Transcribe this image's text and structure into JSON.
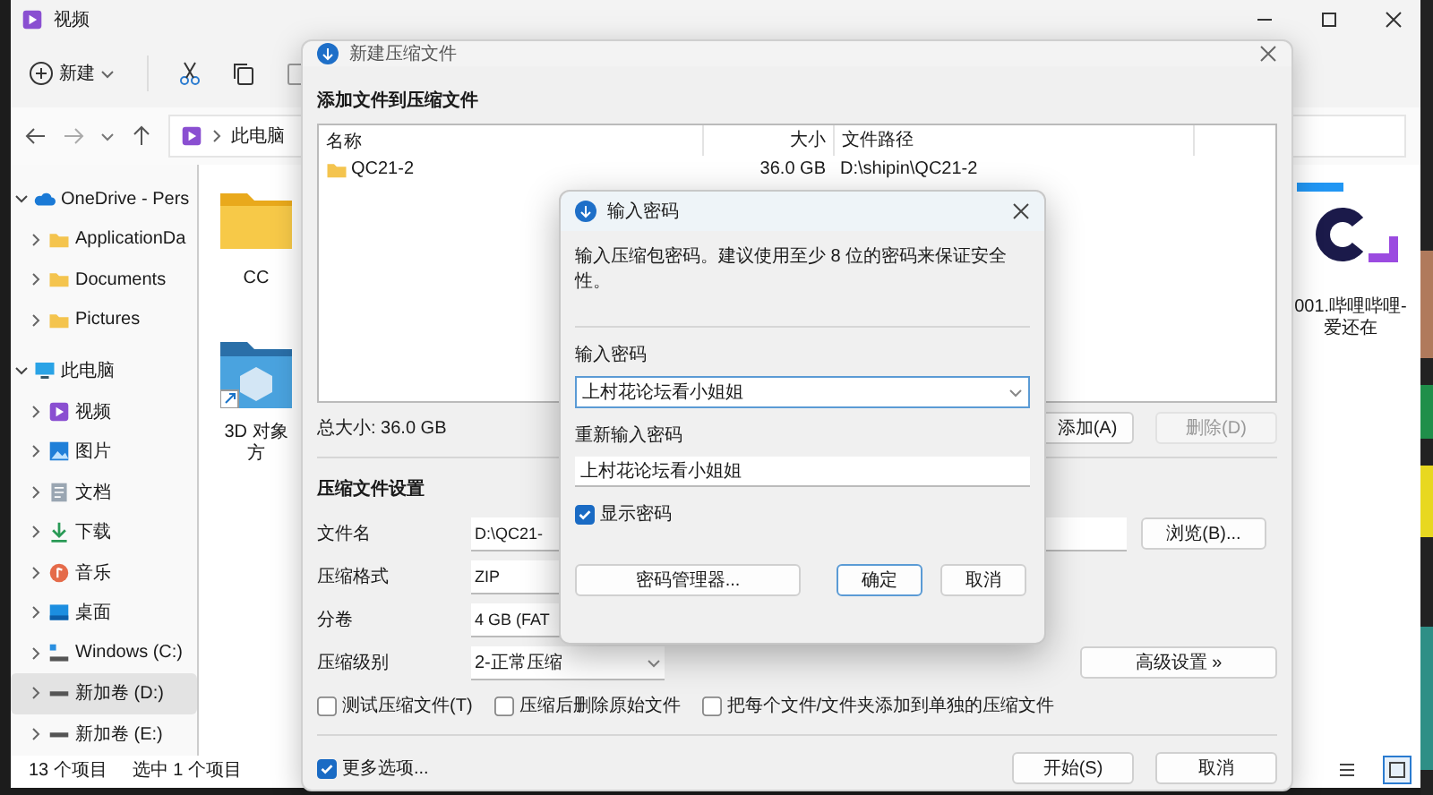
{
  "explorer": {
    "title": "视频",
    "new_button": "新建",
    "address_crumb": "此电脑",
    "sidebar": {
      "items": [
        {
          "label": "OneDrive - Pers",
          "expanded": true,
          "selected": false,
          "children": [
            {
              "label": "ApplicationDa",
              "expanded": false,
              "selected": false
            },
            {
              "label": "Documents",
              "expanded": false,
              "selected": false
            },
            {
              "label": "Pictures",
              "expanded": false,
              "selected": false
            }
          ]
        },
        {
          "label": "此电脑",
          "expanded": true,
          "selected": false,
          "children": [
            {
              "label": "视频",
              "expanded": false,
              "selected": false
            },
            {
              "label": "图片",
              "expanded": false,
              "selected": false
            },
            {
              "label": "文档",
              "expanded": false,
              "selected": false
            },
            {
              "label": "下载",
              "expanded": false,
              "selected": false
            },
            {
              "label": "音乐",
              "expanded": false,
              "selected": false
            },
            {
              "label": "桌面",
              "expanded": false,
              "selected": false
            },
            {
              "label": "Windows (C:)",
              "expanded": false,
              "selected": false
            },
            {
              "label": "新加卷 (D:)",
              "expanded": false,
              "selected": true
            },
            {
              "label": "新加卷 (E:)",
              "expanded": false,
              "selected": false
            }
          ]
        }
      ]
    },
    "files": [
      {
        "kind": "folder",
        "lines": [
          "CC"
        ]
      },
      {
        "kind": "folder-3d",
        "lines": [
          "3D 对象",
          "方"
        ]
      },
      {
        "kind": "video",
        "lines": [
          "001.哔哩哔哩-",
          "爱还在"
        ]
      }
    ],
    "status_bar": {
      "count": "13 个项目",
      "selection": "选中 1 个项目"
    },
    "view_buttons": [
      {
        "kind": "details",
        "selected": false
      },
      {
        "kind": "tiles",
        "selected": true
      }
    ]
  },
  "compress_dialog": {
    "title": "新建压缩文件",
    "files_heading": "添加文件到压缩文件",
    "columns": [
      "名称",
      "大小",
      "文件路径"
    ],
    "rows": [
      {
        "name": "QC21-2",
        "size": "36.0 GB",
        "path": "D:\\shipin\\QC21-2"
      }
    ],
    "total": "总大小: 36.0 GB",
    "list_buttons": [
      {
        "label": "添加(A)",
        "disabled": false
      },
      {
        "label": "删除(D)",
        "disabled": true
      }
    ],
    "settings_heading": "压缩文件设置",
    "fields": [
      {
        "label": "文件名",
        "value": "D:\\QC21-",
        "kind": "wide"
      },
      {
        "label": "压缩格式",
        "value": "ZIP",
        "kind": "text"
      },
      {
        "label": "分卷",
        "value": "4 GB (FAT",
        "kind": "text"
      },
      {
        "label": "压缩级别",
        "value": "2-正常压缩",
        "kind": "select"
      }
    ],
    "browse_button": "浏览(B)...",
    "advanced_button": "高级设置 »",
    "options": [
      {
        "label": "测试压缩文件(T)",
        "checked": false
      },
      {
        "label": "压缩后删除原始文件",
        "checked": false
      },
      {
        "label": "把每个文件/文件夹添加到单独的压缩文件",
        "checked": false
      }
    ],
    "more_options": {
      "label": "更多选项...",
      "checked": true
    },
    "actions": [
      "开始(S)",
      "取消"
    ]
  },
  "password_dialog": {
    "title": "输入密码",
    "hint": "输入压缩包密码。建议使用至少 8 位的密码来保证安全性。",
    "password_label": "输入密码",
    "password": "上村花论坛看小姐姐",
    "confirm_label": "重新输入密码",
    "confirm": "上村花论坛看小姐姐",
    "show_password": {
      "label": "显示密码",
      "checked": true
    },
    "buttons": [
      {
        "label": "密码管理器...",
        "default": false
      },
      {
        "label": "确定",
        "default": true
      },
      {
        "label": "取消",
        "default": false
      }
    ]
  }
}
